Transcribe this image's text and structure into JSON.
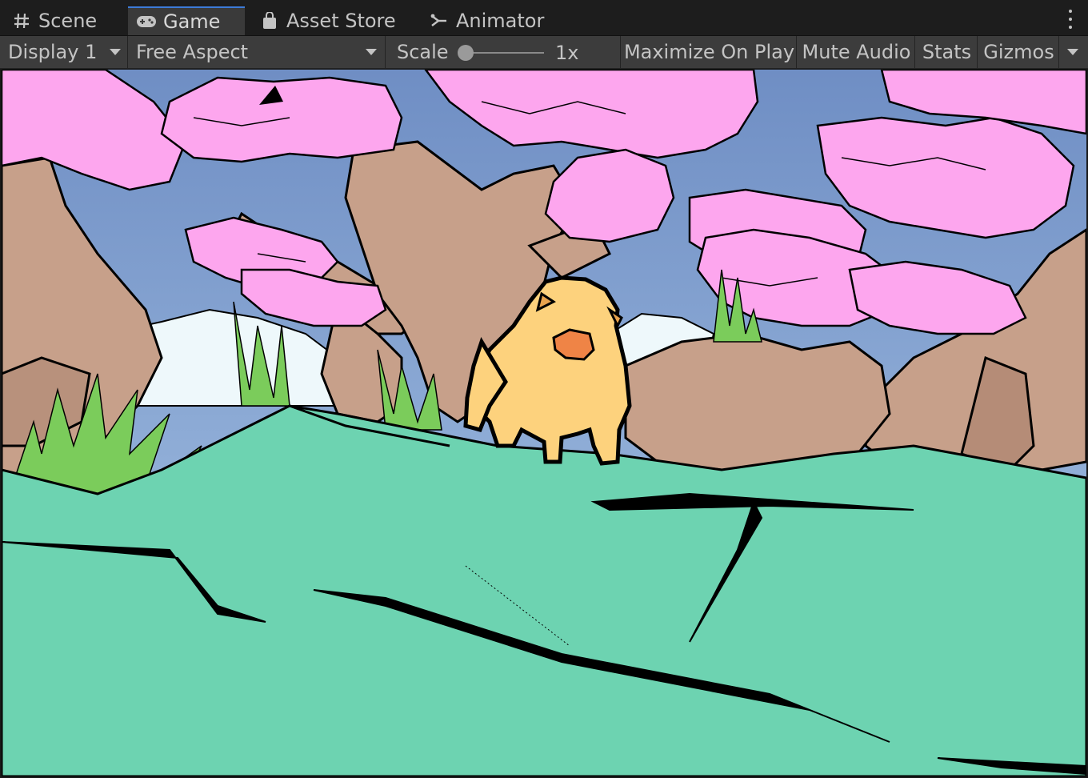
{
  "tabs": [
    {
      "label": "Scene",
      "icon": "grid-icon",
      "active": false
    },
    {
      "label": "Game",
      "icon": "gamepad-icon",
      "active": true
    },
    {
      "label": "Asset Store",
      "icon": "shopping-bag-icon",
      "active": false
    },
    {
      "label": "Animator",
      "icon": "animator-icon",
      "active": false
    }
  ],
  "toolbar": {
    "display_label": "Display 1",
    "aspect_label": "Free Aspect",
    "scale_label": "Scale",
    "scale_value": "1x",
    "maximize_label": "Maximize On Play",
    "mute_label": "Mute Audio",
    "stats_label": "Stats",
    "gizmos_label": "Gizmos"
  },
  "colors": {
    "accent": "#3d7bd8",
    "ground": "#6dd3b1",
    "blossom": "#fda6ee",
    "trunk": "#c7a08a",
    "sky": "#7d9acb",
    "character": "#fdd27d",
    "grass": "#7bcc5b"
  }
}
